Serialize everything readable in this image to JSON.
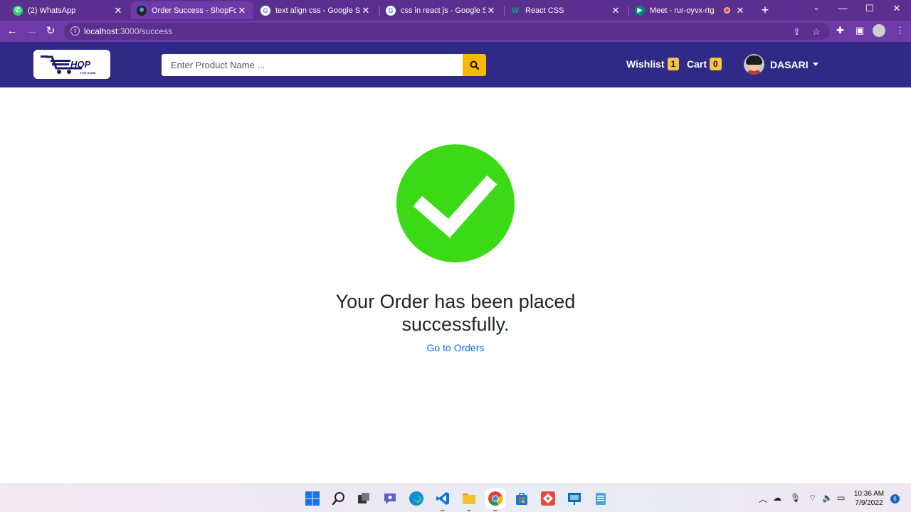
{
  "browser": {
    "tabs": [
      {
        "title": "(2) WhatsApp",
        "favicon": "whatsapp-icon",
        "color": "#25d366"
      },
      {
        "title": "Order Success - ShopForHome",
        "favicon": "react-icon",
        "color": "#61dafb"
      },
      {
        "title": "text align css - Google Search",
        "favicon": "google-icon",
        "color": "#ffffff"
      },
      {
        "title": "css in react js - Google Search",
        "favicon": "google-icon",
        "color": "#ffffff"
      },
      {
        "title": "React CSS",
        "favicon": "w3schools-icon",
        "color": "#04aa6d"
      },
      {
        "title": "Meet - rur-oyvx-rtg",
        "favicon": "google-meet-icon",
        "color": "#00897b"
      }
    ],
    "active_tab_index": 1,
    "url_host": "localhost",
    "url_path": ":3000/success"
  },
  "navbar": {
    "search_placeholder": "Enter Product Name ...",
    "wishlist_label": "Wishlist",
    "wishlist_count": "1",
    "cart_label": "Cart",
    "cart_count": "0",
    "user_name": "DASARI",
    "logo_text": "HOP",
    "logo_sub": "FOR HOME"
  },
  "main": {
    "heading": "Your Order has been placed successfully.",
    "link": "Go to Orders",
    "check_color": "#3cd917"
  },
  "taskbar": {
    "time": "10:36 AM",
    "date": "7/9/2022",
    "notifications": "6"
  },
  "colors": {
    "navbar": "#2f2a86",
    "accent": "#f5b900",
    "browser_frame": "#6e3aa7"
  }
}
